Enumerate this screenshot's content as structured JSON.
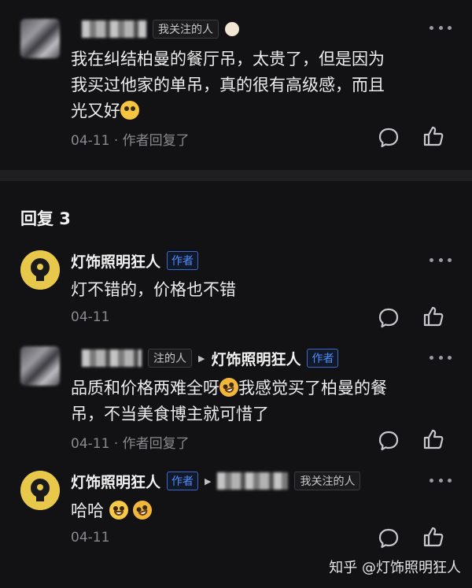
{
  "colors": {
    "background": "#121214",
    "accent": "#4f8ef7",
    "muted": "#8a8a8e"
  },
  "top_comment": {
    "follow_tag": "我关注的人",
    "text_line1": "我在纠结柏曼的餐厅吊，太贵了，但是因为",
    "text_line2": "我买过他家的单吊，真的很有高级感，而且",
    "text_line3": "光又好",
    "emoji": "pleading-face",
    "date": "04-11",
    "author_replied": "作者回复了"
  },
  "section_title": "回复 3",
  "replies": [
    {
      "name": "灯饰照明狂人",
      "tag": "作者",
      "text": "灯不错的，价格也不错",
      "date": "04-11"
    },
    {
      "follow_tag": "注的人",
      "reply_to": "灯饰照明狂人",
      "reply_to_tag": "作者",
      "text_line1_a": "品质和价格两难全呀",
      "text_line1_b": "我感觉买了柏曼的餐",
      "text_line2": "吊，不当美食博主就可惜了",
      "date": "04-11",
      "author_replied": "作者回复了"
    },
    {
      "name": "灯饰照明狂人",
      "tag": "作者",
      "follow_tag": "我关注的人",
      "text": "哈哈",
      "date": "04-11"
    }
  ],
  "watermark": "知乎 @灯饰照明狂人"
}
